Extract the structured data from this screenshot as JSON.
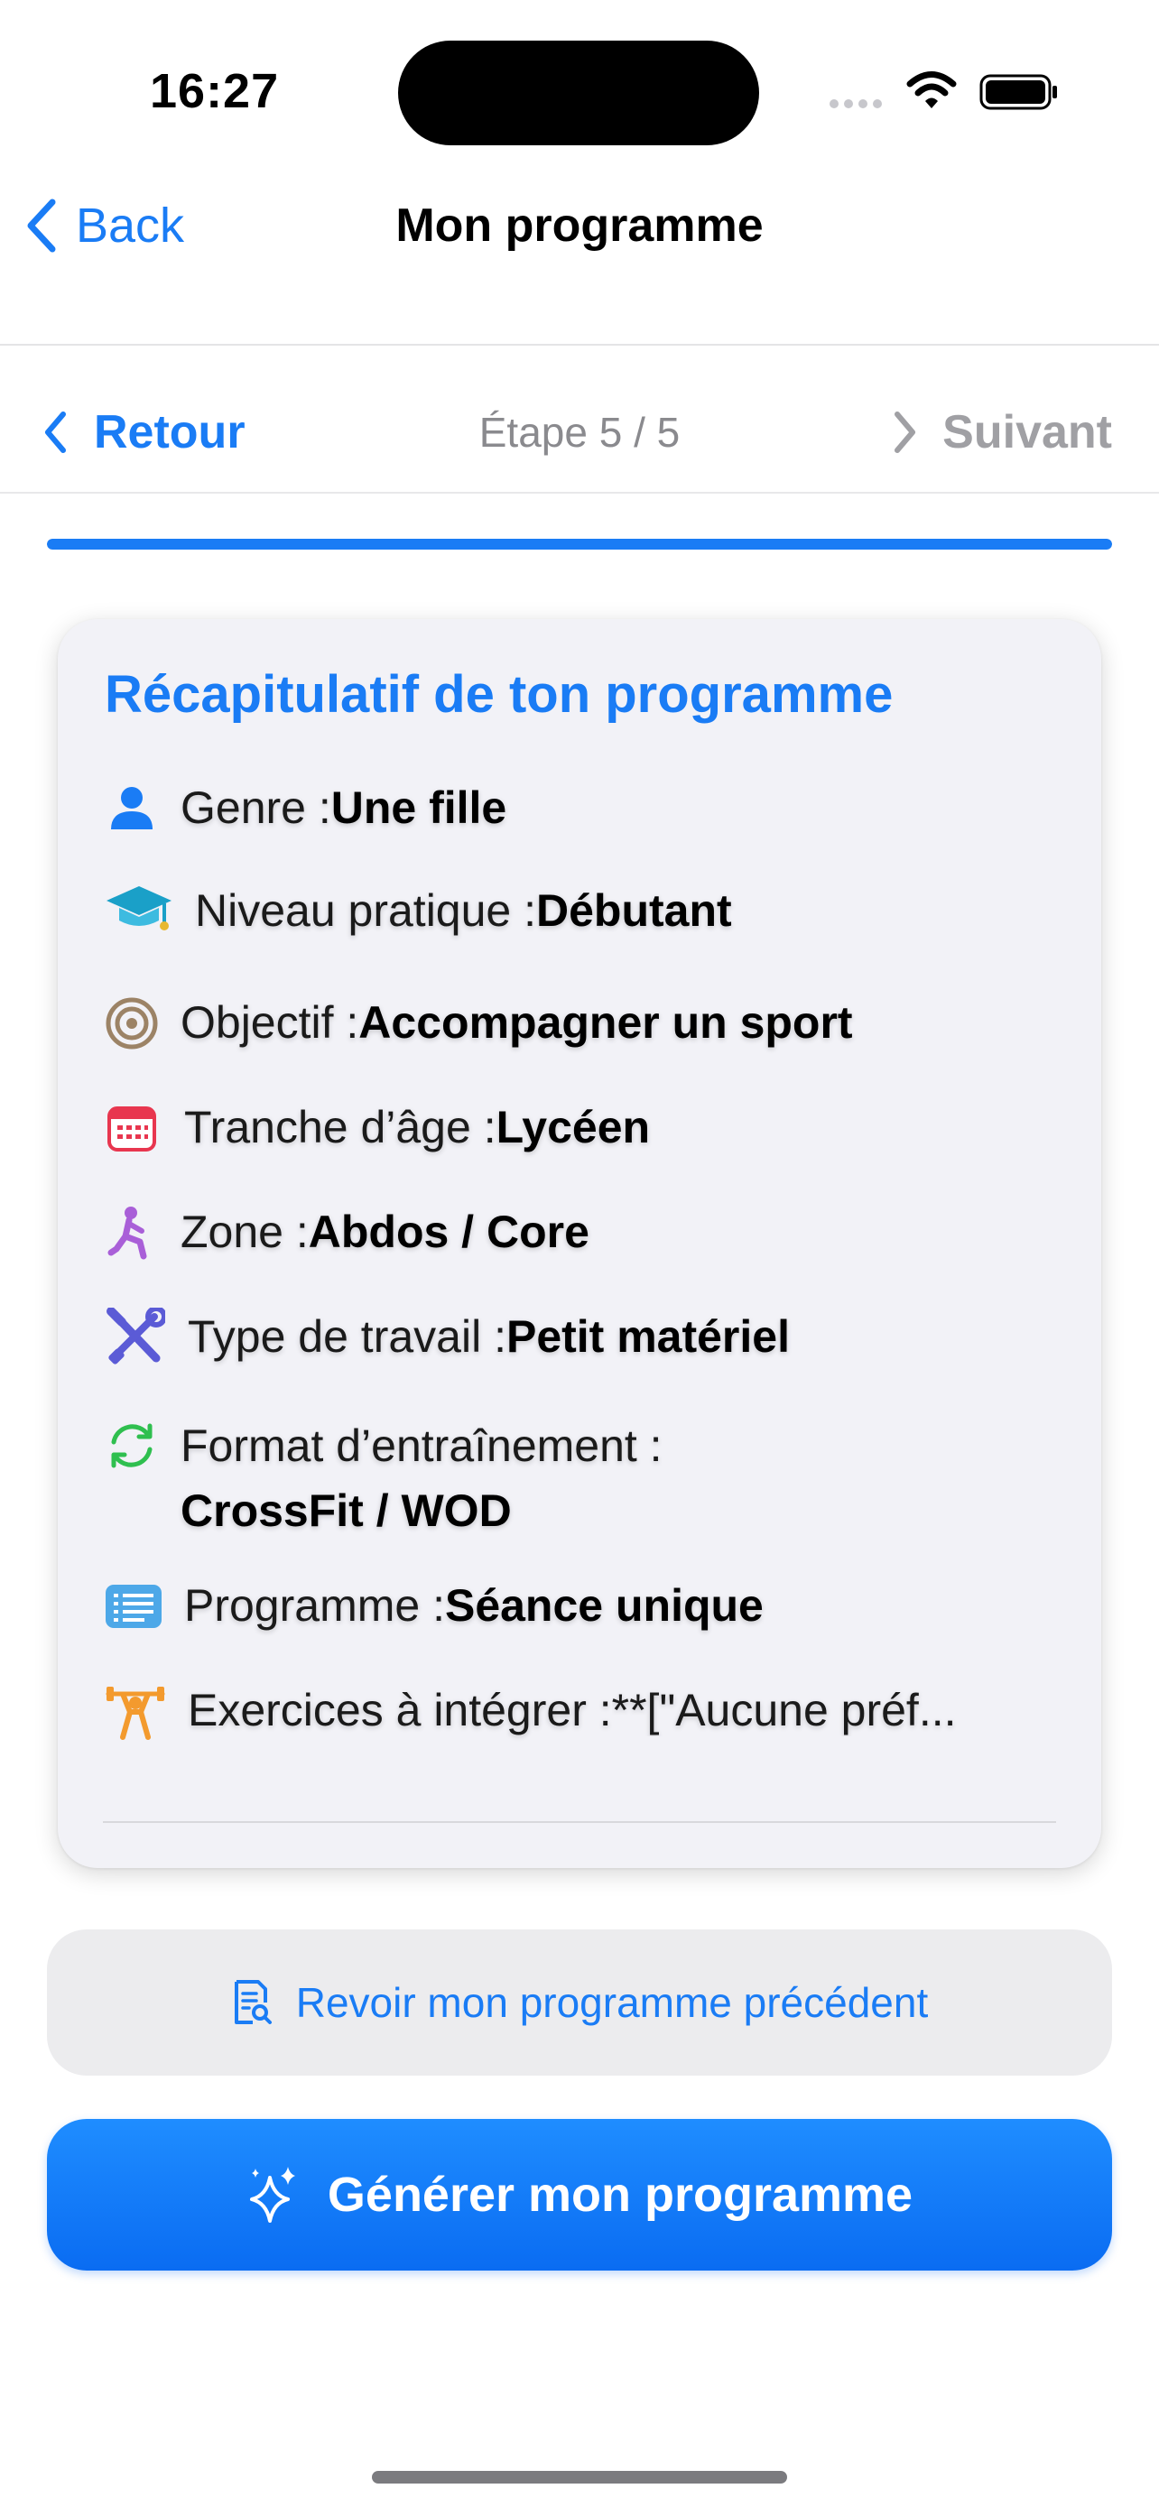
{
  "status_bar": {
    "time": "16:27"
  },
  "nav": {
    "back_label": "Back",
    "title": "Mon programme"
  },
  "stepper": {
    "back_label": "Retour",
    "step_text": "Étape 5 / 5",
    "next_label": "Suivant",
    "progress": 1.0
  },
  "summary": {
    "title": "Récapitulatif de ton programme",
    "rows": [
      {
        "icon": "person-icon",
        "label": "Genre : ",
        "value": "Une fille"
      },
      {
        "icon": "graduation-cap-icon",
        "label": "Niveau pratique : ",
        "value": "Débutant"
      },
      {
        "icon": "target-icon",
        "label": "Objectif : ",
        "value": "Accompagner un sport"
      },
      {
        "icon": "calendar-icon",
        "label": "Tranche d’âge : ",
        "value": "Lycéen"
      },
      {
        "icon": "lunge-figure-icon",
        "label": "Zone : ",
        "value": "Abdos / Core"
      },
      {
        "icon": "tools-icon",
        "label": "Type de travail : ",
        "value": "Petit matériel"
      },
      {
        "icon": "cycle-arrows-icon",
        "label": "Format d’entraînement :",
        "value": "CrossFit / WOD"
      },
      {
        "icon": "list-icon",
        "label": "Programme : ",
        "value": "Séance unique"
      },
      {
        "icon": "weightlifter-icon",
        "label": "Exercices à intégrer : ",
        "value": "**[\"Aucune préf..."
      }
    ]
  },
  "actions": {
    "previous_label": "Revoir mon programme précédent",
    "generate_label": "Générer mon programme"
  },
  "colors": {
    "accent": "#1a7cf5",
    "card_bg": "#f2f2f7",
    "muted": "#8a8a8e"
  }
}
